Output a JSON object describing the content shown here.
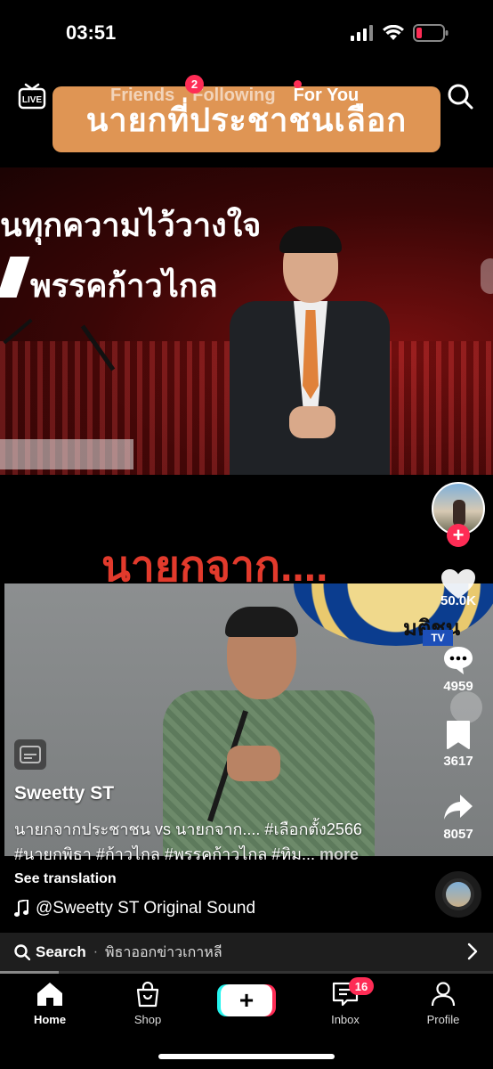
{
  "status_bar": {
    "time": "03:51"
  },
  "top_nav": {
    "live_label": "LIVE",
    "tabs": [
      {
        "label": "Friends"
      },
      {
        "label": "Following"
      },
      {
        "label": "For You"
      }
    ],
    "friends_badge": "2"
  },
  "video": {
    "overlay_title": "นายกที่ประชาชนเลือก",
    "frame1_text_line1": "นทุกความไว้วางใจ",
    "frame1_text_line2": "พรรคก้าวไกล",
    "middle_text": "นายกจาก....",
    "frame2_seal_text": "มติชน",
    "frame2_tv_badge": "TV"
  },
  "sidebar": {
    "likes": "50.0K",
    "comments": "4959",
    "bookmarks": "3617",
    "shares": "8057"
  },
  "post": {
    "username": "Sweetty ST",
    "caption_line1": "นายกจากประชาชน vs นายกจาก....  #เลือกตั้ง2566",
    "caption_line2": "#นายกพิธา #ก้าวไกล #พรรคก้าวไกล #ทิม...",
    "more": " more",
    "see_translation": "See translation",
    "sound": "@Sweetty ST Original Sound"
  },
  "search_bar": {
    "label": "Search",
    "separator": "·",
    "query": "พิธาออกข่าวเกาหลี"
  },
  "playback_progress": 0.12,
  "bottom_nav": {
    "home": "Home",
    "shop": "Shop",
    "inbox": "Inbox",
    "inbox_badge": "16",
    "profile": "Profile"
  },
  "colors": {
    "accent": "#fe2c55",
    "create_cyan": "#25f4ee",
    "banner": "#f0a05a",
    "middle_text": "#e23a2c"
  }
}
